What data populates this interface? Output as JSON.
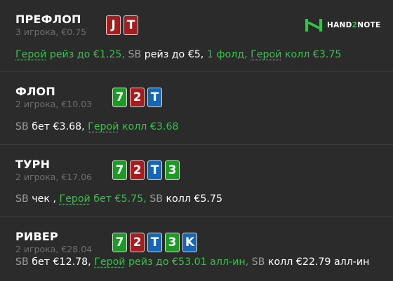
{
  "streets": [
    {
      "name": "ПРЕФЛОП",
      "subtitle": "3 игрока, €0.75",
      "cards": [
        {
          "rank": "J",
          "suit_color": "#a31e1e"
        },
        {
          "rank": "T",
          "suit_color": "#a31e1e"
        }
      ],
      "actions": [
        "Герой",
        "рейз до €1.25",
        ",",
        "SB",
        "рейз до €5",
        ",",
        "1 фолд",
        ",",
        "Герой",
        "колл €3.75"
      ]
    },
    {
      "name": "ФЛОП",
      "subtitle": "2 игрока, €10.03",
      "cards": [
        {
          "rank": "7",
          "suit_color": "#1d9926"
        },
        {
          "rank": "2",
          "suit_color": "#a31e1e"
        },
        {
          "rank": "T",
          "suit_color": "#1466b8"
        }
      ],
      "actions": [
        "SB",
        "бет €3.68",
        ",",
        "Герой",
        "колл €3.68"
      ]
    },
    {
      "name": "ТУРН",
      "subtitle": "2 игрока, €17.06",
      "cards": [
        {
          "rank": "7",
          "suit_color": "#1d9926"
        },
        {
          "rank": "2",
          "suit_color": "#a31e1e"
        },
        {
          "rank": "T",
          "suit_color": "#1466b8"
        },
        {
          "rank": "3",
          "suit_color": "#1d9926"
        }
      ],
      "actions": [
        "SB",
        "чек ,",
        "Герой",
        "бет €5.75,",
        "SB",
        "колл €5.75"
      ]
    },
    {
      "name": "РИВЕР",
      "subtitle": "2 игрока, €28.04",
      "cards": [
        {
          "rank": "7",
          "suit_color": "#1d9926"
        },
        {
          "rank": "2",
          "suit_color": "#a31e1e"
        },
        {
          "rank": "T",
          "suit_color": "#1466b8"
        },
        {
          "rank": "3",
          "suit_color": "#1d9926"
        },
        {
          "rank": "K",
          "suit_color": "#1466b8"
        }
      ],
      "actions": [
        "SB",
        "бет €12.78",
        ",",
        "Герой",
        "рейз до €53.01 алл-ин",
        ",",
        "SB",
        "колл €22.79 алл-ин"
      ]
    }
  ],
  "logo": {
    "part1": "HAND",
    "part2": "2",
    "part3": "NOTE",
    "icon": "h2n-logo-icon",
    "accent": "#35c24a"
  }
}
